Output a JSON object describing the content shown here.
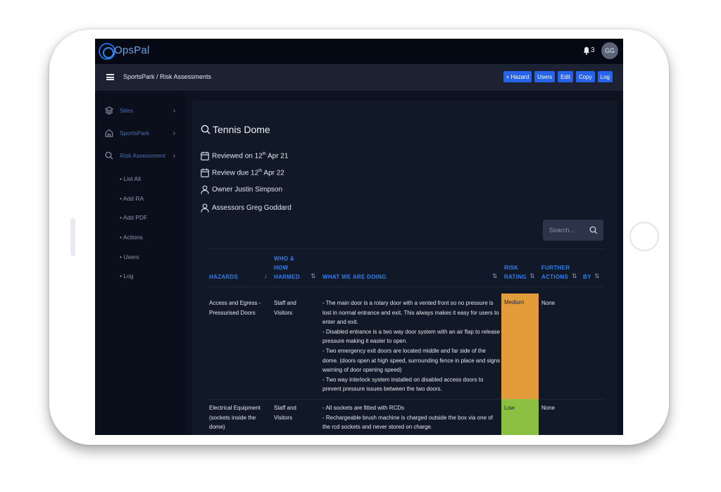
{
  "app": {
    "name": "OpsPal",
    "notifications": "3",
    "user_initials": "GG"
  },
  "subbar": {
    "breadcrumb": "SportsPark / Risk Assessments",
    "buttons": [
      "+ Hazard",
      "Users",
      "Edit",
      "Copy",
      "Log"
    ]
  },
  "sidebar": {
    "items": [
      {
        "label": "Sites",
        "icon": "layers-icon"
      },
      {
        "label": "SportsPark",
        "icon": "home-icon"
      },
      {
        "label": "Risk Assessment",
        "icon": "search-icon"
      }
    ],
    "subitems": [
      "List All",
      "Add RA",
      "Add PDF",
      "Actions",
      "Users",
      "Log"
    ]
  },
  "assessment": {
    "title": "Tennis Dome",
    "reviewed_prefix": "Reviewed on 12",
    "reviewed_sup": "th",
    "reviewed_suffix": " Apr 21",
    "due_prefix": "Review due 12",
    "due_sup": "th",
    "due_suffix": " Apr 22",
    "owner": "Owner Justin Simpson",
    "assessors": "Assessors Greg Goddard"
  },
  "search": {
    "placeholder": "Search..."
  },
  "table": {
    "headers": {
      "hazards": "HAZARDS",
      "who": "WHO &\nHOW\nHARMED",
      "what": "WHAT WE ARE DOING",
      "risk": "RISK\nRATING",
      "further": "FURTHER\nACTIONS",
      "by": "BY"
    },
    "rows": [
      {
        "hazard": "Access and Egress - Pressurised Doors",
        "who": "Staff and Visitors",
        "what": "- The main door is a rotary door with a vented front so no pressure is lost in normal entrance and exit. This always makes it easy for users to enter and exit.\n- Disabled entrance is a two way door system with an air flap to release pressure making it easier to open.\n- Two emergency exit doors are located middle and far side of the dome. (doors open at high speed, surrounding fence in place and signs warning of door opening speed)\n- Two way interlock system installed on disabled access doors to prevent pressure issues between the two doors.",
        "risk": "Medium",
        "further": "None"
      },
      {
        "hazard": "Electrical Equipment (sockets inside the dome)",
        "who": "Staff and Visitors",
        "what": "- All sockets are fitted with RCDs\n- Rechargeable brush machine is charged outside the box via one of the rcd sockets and never stored on charge.",
        "risk": "Low",
        "further": "None"
      }
    ]
  },
  "colors": {
    "medium": "#e39c3a",
    "low": "#8bc042",
    "accent": "#2563eb"
  }
}
